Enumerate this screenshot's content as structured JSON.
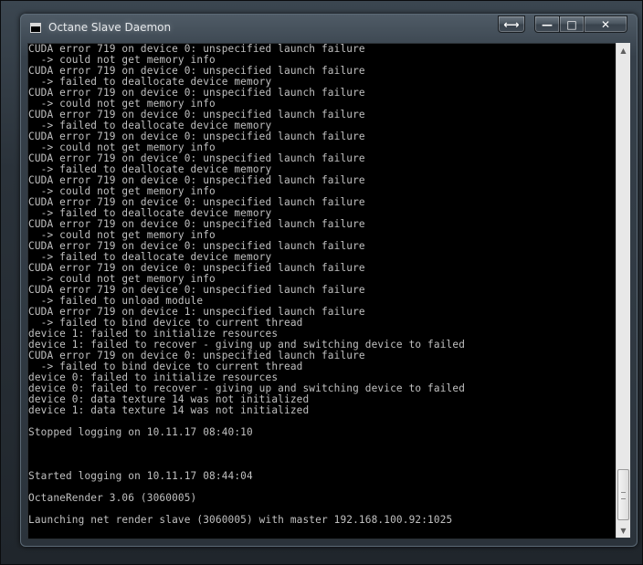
{
  "window": {
    "title": "Octane Slave Daemon",
    "icon": "console-app-icon"
  },
  "titlebar_buttons": {
    "resize_symbol": "⟷",
    "minimize_symbol": "—",
    "maximize_symbol": "□",
    "close_symbol": "✕"
  },
  "console": {
    "lines": [
      "CUDA error 719 on device 0: unspecified launch failure",
      "  -> could not get memory info",
      "CUDA error 719 on device 0: unspecified launch failure",
      "  -> failed to deallocate device memory",
      "CUDA error 719 on device 0: unspecified launch failure",
      "  -> could not get memory info",
      "CUDA error 719 on device 0: unspecified launch failure",
      "  -> failed to deallocate device memory",
      "CUDA error 719 on device 0: unspecified launch failure",
      "  -> could not get memory info",
      "CUDA error 719 on device 0: unspecified launch failure",
      "  -> failed to deallocate device memory",
      "CUDA error 719 on device 0: unspecified launch failure",
      "  -> could not get memory info",
      "CUDA error 719 on device 0: unspecified launch failure",
      "  -> failed to deallocate device memory",
      "CUDA error 719 on device 0: unspecified launch failure",
      "  -> could not get memory info",
      "CUDA error 719 on device 0: unspecified launch failure",
      "  -> failed to deallocate device memory",
      "CUDA error 719 on device 0: unspecified launch failure",
      "  -> could not get memory info",
      "CUDA error 719 on device 0: unspecified launch failure",
      "  -> failed to unload module",
      "CUDA error 719 on device 1: unspecified launch failure",
      "  -> failed to bind device to current thread",
      "device 1: failed to initialize resources",
      "device 1: failed to recover - giving up and switching device to failed",
      "CUDA error 719 on device 0: unspecified launch failure",
      "  -> failed to bind device to current thread",
      "device 0: failed to initialize resources",
      "device 0: failed to recover - giving up and switching device to failed",
      "device 0: data texture 14 was not initialized",
      "device 1: data texture 14 was not initialized",
      "",
      "Stopped logging on 10.11.17 08:40:10",
      "",
      "",
      "",
      "Started logging on 10.11.17 08:44:04",
      "",
      "OctaneRender 3.06 (3060005)",
      "",
      "Launching net render slave (3060005) with master 192.168.100.92:1025"
    ]
  },
  "scrollbar": {
    "up_arrow": "▲",
    "down_arrow": "▼"
  },
  "colors": {
    "console_text": "#c0c0c0",
    "console_background": "#000000"
  }
}
